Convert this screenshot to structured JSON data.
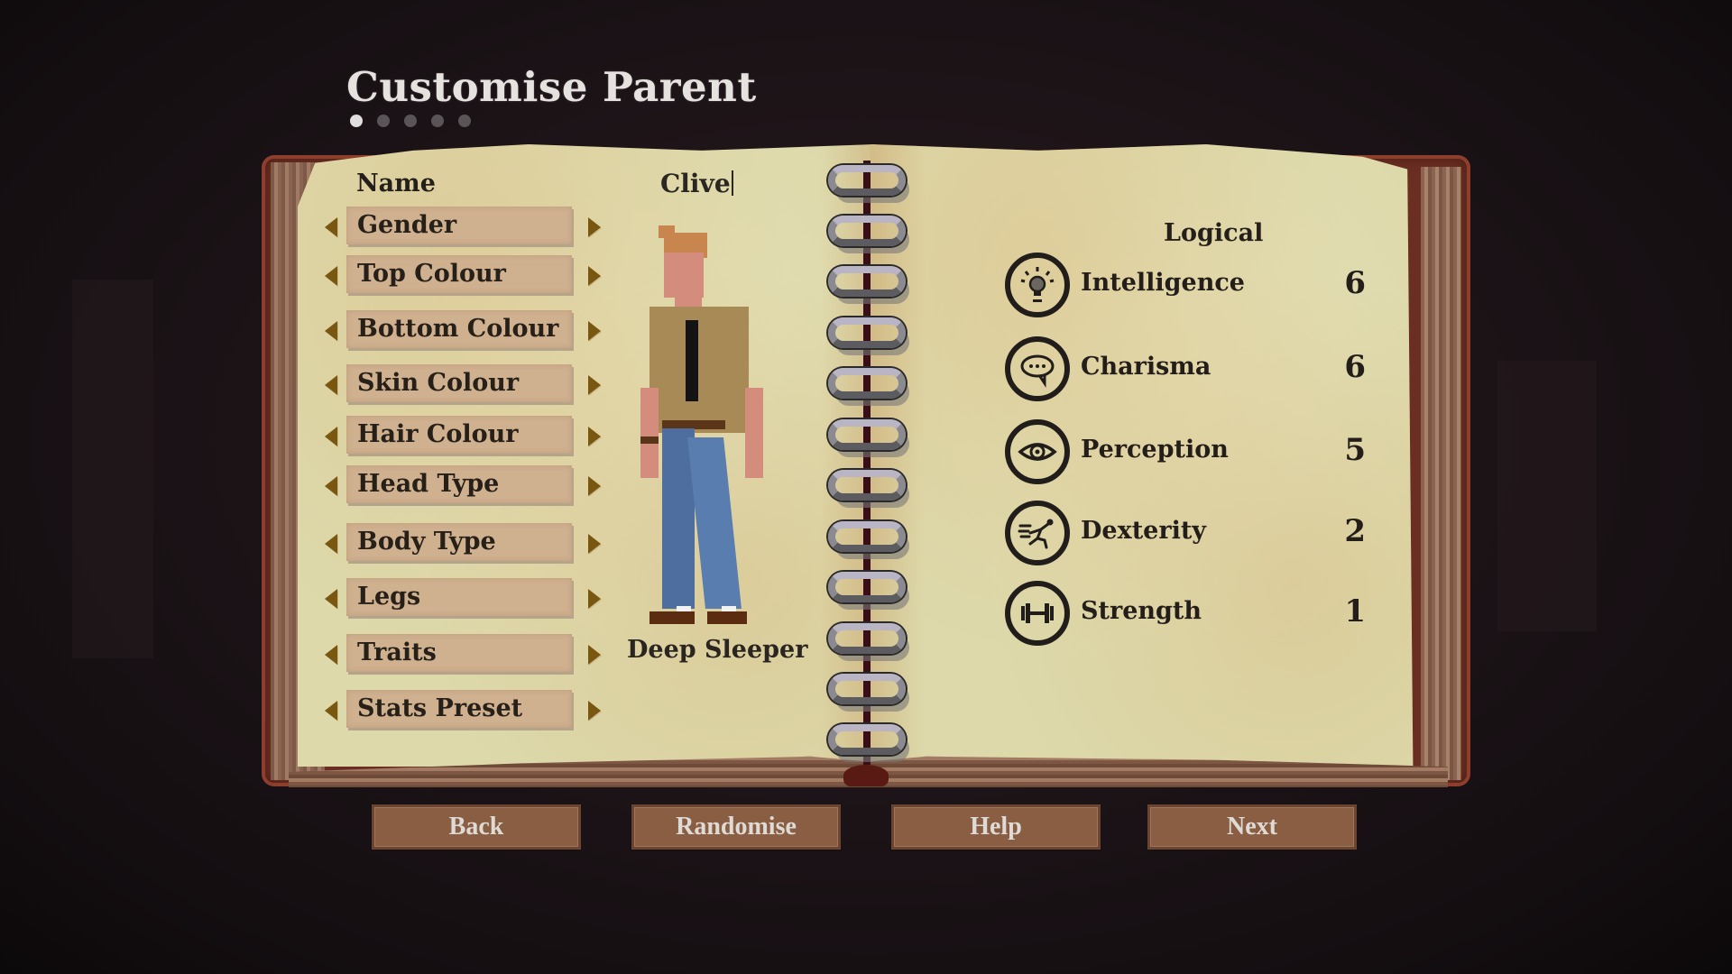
{
  "screen": {
    "title": "Customise Parent",
    "page_indicator": {
      "total": 5,
      "current": 1
    }
  },
  "left_page": {
    "name_label": "Name",
    "name_value": "Clive",
    "options": [
      {
        "label": "Gender"
      },
      {
        "label": "Top Colour"
      },
      {
        "label": "Bottom Colour"
      },
      {
        "label": "Skin Colour"
      },
      {
        "label": "Hair Colour"
      },
      {
        "label": "Head Type"
      },
      {
        "label": "Body Type"
      },
      {
        "label": "Legs"
      },
      {
        "label": "Traits"
      },
      {
        "label": "Stats Preset"
      }
    ],
    "trait_value": "Deep Sleeper"
  },
  "right_page": {
    "category": "Logical",
    "stats": [
      {
        "name": "Intelligence",
        "value": "6",
        "icon": "lightbulb-icon"
      },
      {
        "name": "Charisma",
        "value": "6",
        "icon": "speech-bubble-icon"
      },
      {
        "name": "Perception",
        "value": "5",
        "icon": "eye-icon"
      },
      {
        "name": "Dexterity",
        "value": "2",
        "icon": "running-figure-icon"
      },
      {
        "name": "Strength",
        "value": "1",
        "icon": "dumbbell-icon"
      }
    ]
  },
  "buttons": {
    "back": "Back",
    "randomise": "Randomise",
    "help": "Help",
    "next": "Next"
  },
  "colors": {
    "paper": "#ddd9ab",
    "option_box": "#cfb08f",
    "arrow": "#7a5710",
    "button": "#8a5e42",
    "cover": "#6b2e22"
  }
}
